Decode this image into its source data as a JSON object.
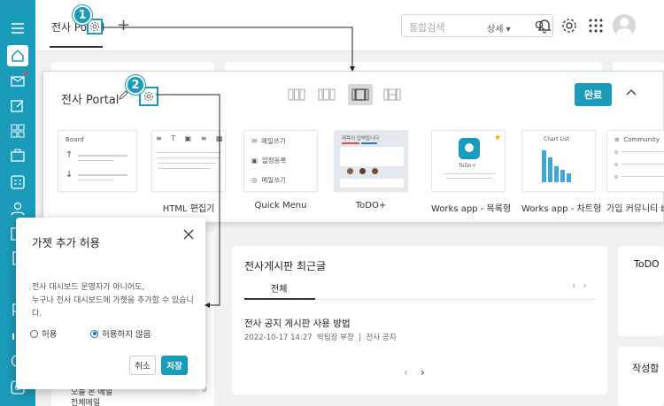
{
  "topbar": {
    "tab_label": "전사 Portal",
    "search_placeholder": "통합검색",
    "search_detail": "상세",
    "icons": [
      "bell-icon",
      "gear-icon",
      "apps-grid-icon"
    ]
  },
  "sidebar": {
    "icons": [
      "menu-icon",
      "home-icon",
      "mail-icon",
      "edit-icon",
      "grid-icon",
      "briefcase-icon",
      "form-icon",
      "person-icon",
      "calendar-icon",
      "file-icon",
      "dots-icon",
      "flag-icon",
      "chart-icon",
      "clock-icon",
      "settings-icon"
    ]
  },
  "edit_panel": {
    "title": "전사 Portal",
    "done_label": "완료",
    "widgets": [
      {
        "label": "HTML 편집기",
        "thumb_title": "Board"
      },
      {
        "label": "Quick Menu",
        "thumb_items": [
          "메일쓰기",
          "일정등록",
          "메일쓰기"
        ]
      },
      {
        "label": "ToDO+",
        "thumb_title": "제목이 입력됩니다"
      },
      {
        "label": "Works app - 목록형",
        "thumb_title": "ToDo+"
      },
      {
        "label": "Works app - 차트형",
        "thumb_title": "Chart List"
      },
      {
        "label": "가입 커뮤니티 b",
        "thumb_title": "Community"
      }
    ]
  },
  "board_card": {
    "title": "전사게시판 최근글",
    "tab": "전체",
    "post_title": "전사 공지 게시판 사용 방법",
    "post_date": "2022-10-17 14:27",
    "post_author": "박팀장 부장",
    "post_board": "전사 공지"
  },
  "side_cards": {
    "todo": "ToDO",
    "write": "작성함"
  },
  "left_card": {
    "line1": "오늘 온 메일",
    "line2": "전체메일",
    "count": "0"
  },
  "dialog": {
    "title": "가젯 추가 허용",
    "desc_line1": "전사 대시보드 운영자가 아니어도,",
    "desc_line2": "누구나 전사 대시보드에 가젯을 추가할 수 있습니다.",
    "option_allow": "허용",
    "option_deny": "허용하지 않음",
    "selected": "허용하지 않음",
    "cancel_label": "취소",
    "save_label": "저장"
  },
  "callouts": {
    "badge1": "1",
    "badge2": "2"
  },
  "colors": {
    "accent": "#1a9bb9",
    "sidebar": "#1a9bb9",
    "radio": "#1a6fcf"
  }
}
